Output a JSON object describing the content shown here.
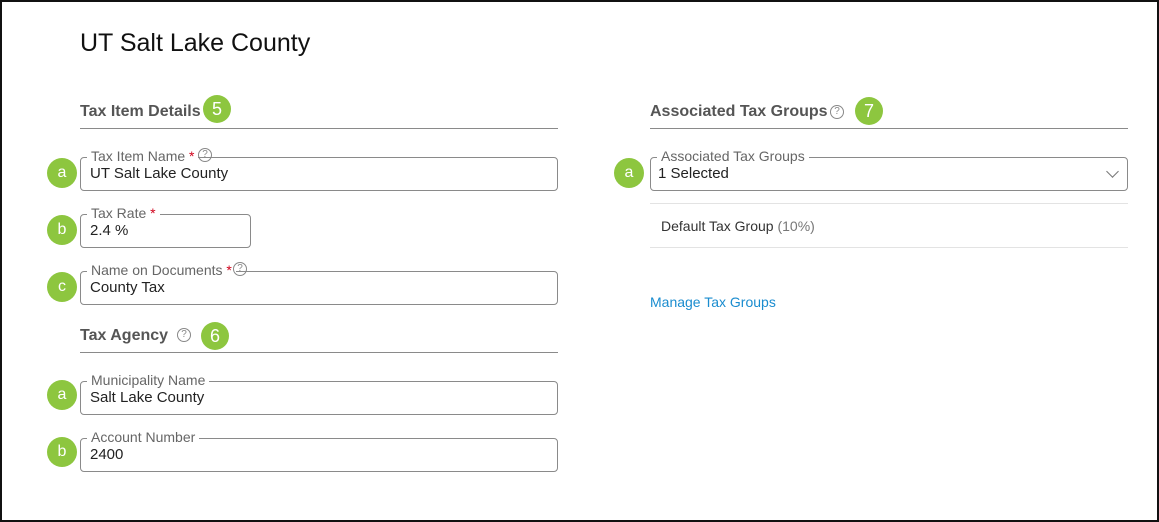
{
  "page": {
    "title": "UT Salt Lake County"
  },
  "tax_item_details": {
    "heading": "Tax Item Details",
    "badge": "5",
    "fields": {
      "tax_item_name": {
        "label": "Tax Item Name",
        "required": "*",
        "value": "UT Salt Lake County",
        "badge": "a"
      },
      "tax_rate": {
        "label": "Tax Rate",
        "required": "*",
        "value": "2.4 %",
        "badge": "b"
      },
      "name_on_documents": {
        "label": "Name on Documents",
        "required": "*",
        "value": "County Tax",
        "badge": "c"
      }
    }
  },
  "tax_agency": {
    "heading": "Tax Agency",
    "badge": "6",
    "fields": {
      "municipality_name": {
        "label": "Municipality Name",
        "value": "Salt Lake County",
        "badge": "a"
      },
      "account_number": {
        "label": "Account Number",
        "value": "2400",
        "badge": "b"
      }
    }
  },
  "associated_tax_groups": {
    "heading": "Associated Tax Groups",
    "badge": "7",
    "select": {
      "label": "Associated Tax Groups",
      "value": "1 Selected",
      "badge": "a"
    },
    "groups": [
      {
        "name": "Default Tax Group",
        "rate": "(10%)"
      }
    ],
    "manage_link": "Manage Tax Groups"
  },
  "icons": {
    "help": "question-circle-icon",
    "dropdown": "chevron-down-icon"
  },
  "colors": {
    "badge": "#8dc63f",
    "link": "#1a8ccf",
    "required": "#d0021b"
  }
}
